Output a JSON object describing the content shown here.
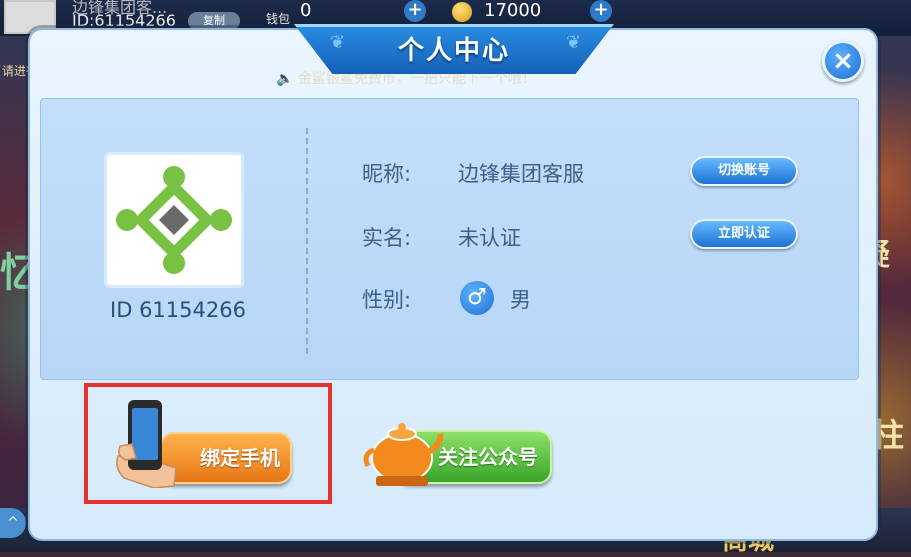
{
  "topbar": {
    "user_name": "边锋集团客...",
    "user_id": "ID:61154266",
    "copy_label": "复制",
    "wallet_label": "钱包",
    "coins_a": "0",
    "coins_b": "17000"
  },
  "background": {
    "verify_hint": "请进行实名认证",
    "notice": "金鲨银鲨免费币，一把只能下一个哦！",
    "shop_label": "商城"
  },
  "dialog": {
    "title": "个人中心",
    "close_label": "×",
    "user_id": "ID 61154266",
    "nickname_label": "昵称:",
    "nickname_value": "边锋集团客服",
    "switch_account_label": "切换账号",
    "realname_label": "实名:",
    "realname_value": "未认证",
    "verify_now_label": "立即认证",
    "gender_label": "性别:",
    "gender_icon": "male-icon",
    "gender_value": "男",
    "bind_phone_label": "绑定手机",
    "follow_label": "关注公众号"
  },
  "colors": {
    "dialog_bg": "#eaf5fe",
    "panel_bg": "#c2defa",
    "title_blue": "#1461b8",
    "highlight_red": "#e5322f",
    "bind_orange": "#e77714",
    "follow_green": "#3aa52a",
    "avatar_green": "#79c142"
  }
}
